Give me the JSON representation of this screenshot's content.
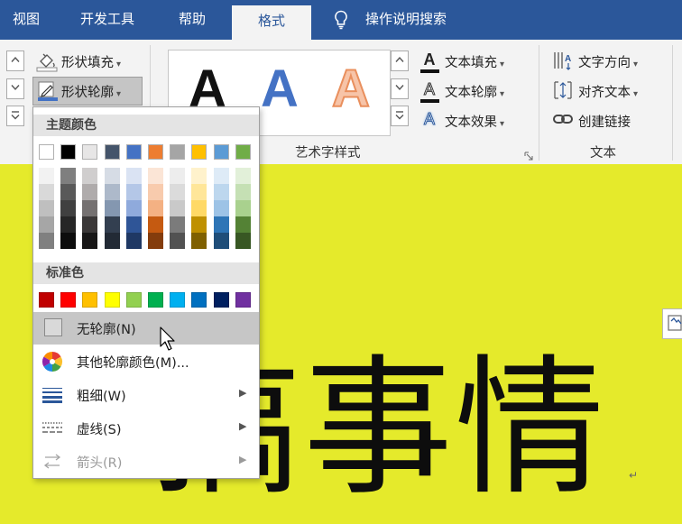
{
  "tabs": [
    {
      "label": "视图",
      "active": false
    },
    {
      "label": "开发工具",
      "active": false
    },
    {
      "label": "帮助",
      "active": false
    },
    {
      "label": "格式",
      "active": true
    }
  ],
  "tell_me": {
    "placeholder": "操作说明搜索",
    "icon": "lightbulb-icon"
  },
  "shape_styles": {
    "fill_label": "形状填充",
    "outline_label": "形状轮廓"
  },
  "wordart": {
    "group_label": "艺术字样式",
    "sample_letter": "A",
    "text_fill": "文本填充",
    "text_outline": "文本轮廓",
    "text_effects": "文本效果"
  },
  "text_group": {
    "group_label": "文本",
    "direction": "文字方向",
    "align": "对齐文本",
    "link": "创建链接"
  },
  "dropdown": {
    "theme_colors_label": "主题颜色",
    "standard_colors_label": "标准色",
    "theme_colors": [
      [
        "#ffffff",
        "#f2f2f2",
        "#d9d9d9",
        "#bfbfbf",
        "#a6a6a6",
        "#808080"
      ],
      [
        "#000000",
        "#7f7f7f",
        "#595959",
        "#404040",
        "#262626",
        "#0d0d0d"
      ],
      [
        "#e7e6e6",
        "#d0cece",
        "#afabab",
        "#757171",
        "#3b3838",
        "#181717"
      ],
      [
        "#44546a",
        "#d6dce5",
        "#adb9ca",
        "#8497b0",
        "#333f50",
        "#222a35"
      ],
      [
        "#4472c4",
        "#dae3f3",
        "#b4c7e7",
        "#8faadc",
        "#2f5597",
        "#1f3864"
      ],
      [
        "#ed7d31",
        "#fbe5d6",
        "#f8cbad",
        "#f4b183",
        "#c55a11",
        "#843c0c"
      ],
      [
        "#a5a5a5",
        "#ededed",
        "#dbdbdb",
        "#c9c9c9",
        "#7b7b7b",
        "#525252"
      ],
      [
        "#ffc000",
        "#fff2cc",
        "#ffe699",
        "#ffd966",
        "#bf9000",
        "#7f6000"
      ],
      [
        "#5b9bd5",
        "#deebf7",
        "#bdd7ee",
        "#9dc3e6",
        "#2e75b6",
        "#1f4e79"
      ],
      [
        "#70ad47",
        "#e2f0d9",
        "#c5e0b4",
        "#a9d18e",
        "#548235",
        "#385723"
      ]
    ],
    "standard_colors": [
      "#c00000",
      "#ff0000",
      "#ffc000",
      "#ffff00",
      "#92d050",
      "#00b050",
      "#00b0f0",
      "#0070c0",
      "#002060",
      "#7030a0"
    ],
    "items": [
      {
        "label": "无轮廓(N)",
        "icon": "no-outline-icon",
        "submenu": false,
        "hover": true,
        "disabled": false
      },
      {
        "label": "其他轮廓颜色(M)...",
        "icon": "color-wheel-icon",
        "submenu": false,
        "hover": false,
        "disabled": false
      },
      {
        "label": "粗细(W)",
        "icon": "line-weight-icon",
        "submenu": true,
        "hover": false,
        "disabled": false
      },
      {
        "label": "虚线(S)",
        "icon": "dash-style-icon",
        "submenu": true,
        "hover": false,
        "disabled": false
      },
      {
        "label": "箭头(R)",
        "icon": "arrow-style-icon",
        "submenu": true,
        "hover": false,
        "disabled": true
      }
    ]
  },
  "document": {
    "visible_text": "搞事情",
    "paragraph_mark": "↵",
    "background_color": "#e5ea2b"
  }
}
